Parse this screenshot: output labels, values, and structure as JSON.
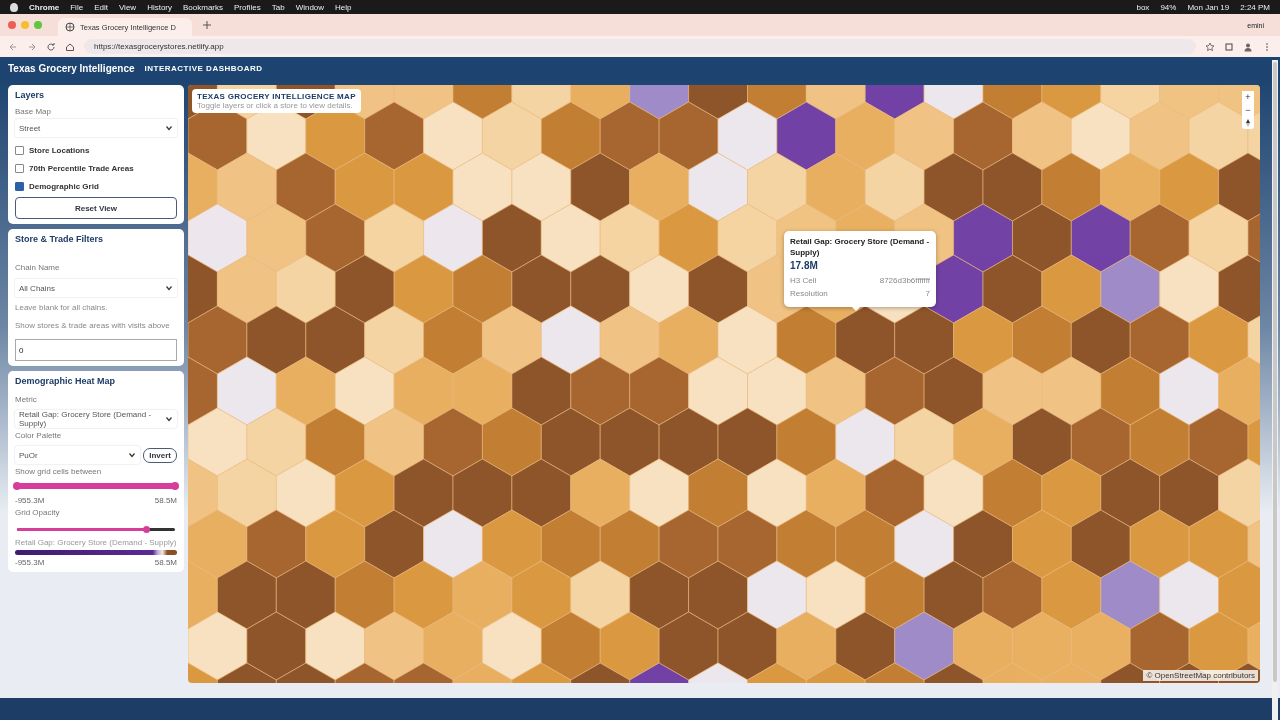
{
  "menu_bar": {
    "app": "Chrome",
    "items": [
      "File",
      "Edit",
      "View",
      "History",
      "Bookmarks",
      "Profiles",
      "Tab",
      "Window",
      "Help"
    ],
    "status": [
      "box",
      "94%",
      "Mon Jan 19",
      "2:24 PM"
    ]
  },
  "browser": {
    "tab_title": "Texas Grocery Intelligence D",
    "profile_label": "emini",
    "url": "https://texasgrocerystores.netlify.app"
  },
  "header": {
    "title": "Texas Grocery Intelligence",
    "subtitle": "INTERACTIVE DASHBOARD"
  },
  "layers": {
    "title": "Layers",
    "base_map_label": "Base Map",
    "base_map_value": "Street",
    "toggles": [
      {
        "label": "Store Locations",
        "checked": false
      },
      {
        "label": "70th Percentile Trade Areas",
        "checked": false
      },
      {
        "label": "Demographic Grid",
        "checked": true
      }
    ],
    "reset_button": "Reset View"
  },
  "filters": {
    "title": "Store & Trade Filters",
    "chain_label": "Chain Name",
    "chain_value": "All Chains",
    "chain_hint": "Leave blank for all chains.",
    "visits_label": "Show stores & trade areas with visits above",
    "visits_value": "0"
  },
  "heat_map": {
    "title": "Demographic Heat Map",
    "metric_label": "Metric",
    "metric_value": "Retail Gap: Grocery Store (Demand - Supply)",
    "palette_label": "Color Palette",
    "palette_value": "PuOr",
    "invert_button": "Invert",
    "range_label": "Show grid cells between",
    "range_low": {
      "level": 0
    },
    "range_high": {
      "level": 1
    },
    "range_min": "-955.3M",
    "range_max": "58.5M",
    "opacity_label": "Grid Opacity",
    "opacity": {
      "level": 0.82
    },
    "legend_title": "Retail Gap: Grocery Store (Demand - Supply)",
    "legend_min": "-955.3M",
    "legend_max": "58.5M"
  },
  "map": {
    "title_card": {
      "title": "TEXAS GROCERY INTELLIGENCE MAP",
      "subtitle": "Toggle layers or click a store to view details."
    },
    "zoom_in": "+",
    "zoom_out": "−",
    "popup": {
      "title": "Retail Gap: Grocery Store (Demand - Supply)",
      "value": "17.8M",
      "rows": [
        {
          "label": "H3 Cell",
          "value": "8726d3b6fffffff"
        },
        {
          "label": "Resolution",
          "value": "7"
        }
      ]
    },
    "attribution": "© OpenStreetMap contributors"
  }
}
